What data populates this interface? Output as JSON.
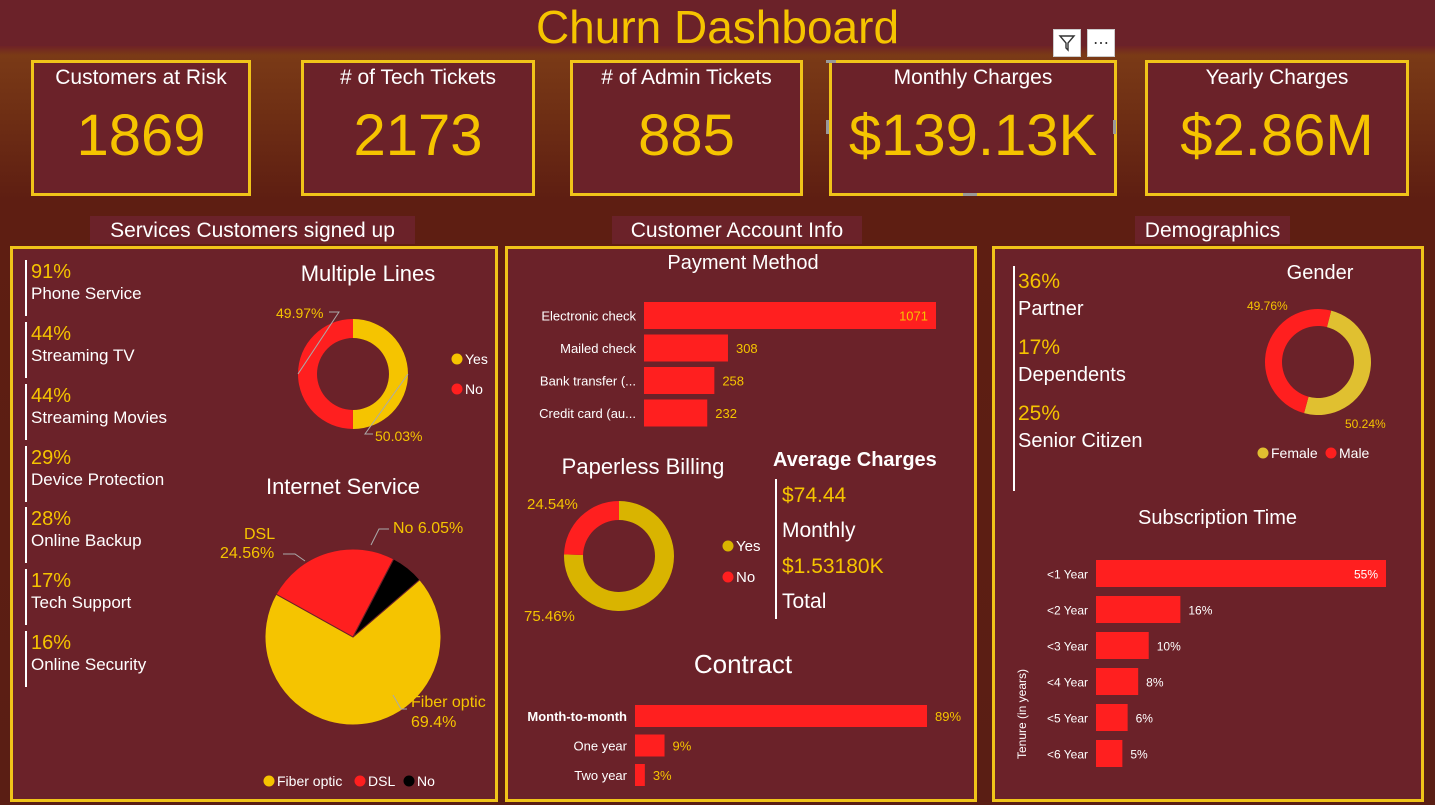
{
  "header": {
    "title": "Churn Dashboard"
  },
  "kpis": [
    {
      "label": "Customers at Risk",
      "value": "1869"
    },
    {
      "label": "# of Tech Tickets",
      "value": "2173"
    },
    {
      "label": "# of Admin Tickets",
      "value": "885"
    },
    {
      "label": "Monthly Charges",
      "value": "$139.13K"
    },
    {
      "label": "Yearly Charges",
      "value": "$2.86M"
    }
  ],
  "sections": {
    "services": "Services Customers signed up",
    "account": "Customer Account Info",
    "demographics": "Demographics"
  },
  "services": [
    {
      "pct": "91%",
      "name": "Phone Service"
    },
    {
      "pct": "44%",
      "name": "Streaming TV"
    },
    {
      "pct": "44%",
      "name": "Streaming Movies"
    },
    {
      "pct": "29%",
      "name": "Device Protection"
    },
    {
      "pct": "28%",
      "name": "Online Backup"
    },
    {
      "pct": "17%",
      "name": "Tech Support"
    },
    {
      "pct": "16%",
      "name": "Online Security"
    }
  ],
  "average_charges": {
    "title": "Average Charges",
    "monthly_value": "$74.44",
    "monthly_label": "Monthly",
    "total_value": "$1.53180K",
    "total_label": "Total"
  },
  "demographics": [
    {
      "pct": "36%",
      "name": "Partner"
    },
    {
      "pct": "17%",
      "name": "Dependents"
    },
    {
      "pct": "25%",
      "name": "Senior Citizen"
    }
  ],
  "colors": {
    "accent": "#f5c400",
    "red": "#ff1f1f",
    "panel": "#6b2229",
    "black": "#000000",
    "gold": "#e0c030"
  },
  "icons": {
    "filter": "filter-icon",
    "more": "more-options-icon"
  },
  "chart_data": [
    {
      "id": "multiple_lines",
      "type": "donut",
      "title": "Multiple Lines",
      "slices": [
        {
          "name": "Yes",
          "value": 50.03,
          "label": "50.03%"
        },
        {
          "name": "No",
          "value": 49.97,
          "label": "49.97%"
        }
      ],
      "legend": [
        "Yes",
        "No"
      ]
    },
    {
      "id": "internet_service",
      "type": "pie",
      "title": "Internet Service",
      "slices": [
        {
          "name": "Fiber optic",
          "value": 69.4,
          "label_name": "Fiber optic",
          "label_value": "69.4%"
        },
        {
          "name": "DSL",
          "value": 24.56,
          "label_name": "DSL",
          "label_value": "24.56%"
        },
        {
          "name": "No",
          "value": 6.05,
          "label_name": "No",
          "label_value": "6.05%"
        }
      ],
      "legend": [
        "Fiber optic",
        "DSL",
        "No"
      ]
    },
    {
      "id": "payment_method",
      "type": "bar",
      "title": "Payment Method",
      "categories": [
        "Electronic check",
        "Mailed check",
        "Bank transfer (...",
        "Credit card (au..."
      ],
      "values": [
        1071,
        308,
        258,
        232
      ]
    },
    {
      "id": "paperless_billing",
      "type": "donut",
      "title": "Paperless Billing",
      "slices": [
        {
          "name": "Yes",
          "value": 75.46,
          "label": "75.46%"
        },
        {
          "name": "No",
          "value": 24.54,
          "label": "24.54%"
        }
      ],
      "legend": [
        "Yes",
        "No"
      ]
    },
    {
      "id": "contract",
      "type": "bar",
      "title": "Contract",
      "categories": [
        "Month-to-month",
        "One year",
        "Two year"
      ],
      "values": [
        89,
        9,
        3
      ],
      "labels": [
        "89%",
        "9%",
        "3%"
      ]
    },
    {
      "id": "gender",
      "type": "donut",
      "title": "Gender",
      "slices": [
        {
          "name": "Female",
          "value": 50.24,
          "label": "50.24%"
        },
        {
          "name": "Male",
          "value": 49.76,
          "label": "49.76%"
        }
      ],
      "legend": [
        "Female",
        "Male"
      ]
    },
    {
      "id": "subscription_time",
      "type": "bar",
      "title": "Subscription Time",
      "ylabel": "Tenure (in years)",
      "categories": [
        "<1 Year",
        "<2 Year",
        "<3 Year",
        "<4 Year",
        "<5 Year",
        "<6 Year"
      ],
      "values": [
        55,
        16,
        10,
        8,
        6,
        5
      ],
      "labels": [
        "55%",
        "16%",
        "10%",
        "8%",
        "6%",
        "5%"
      ]
    }
  ]
}
